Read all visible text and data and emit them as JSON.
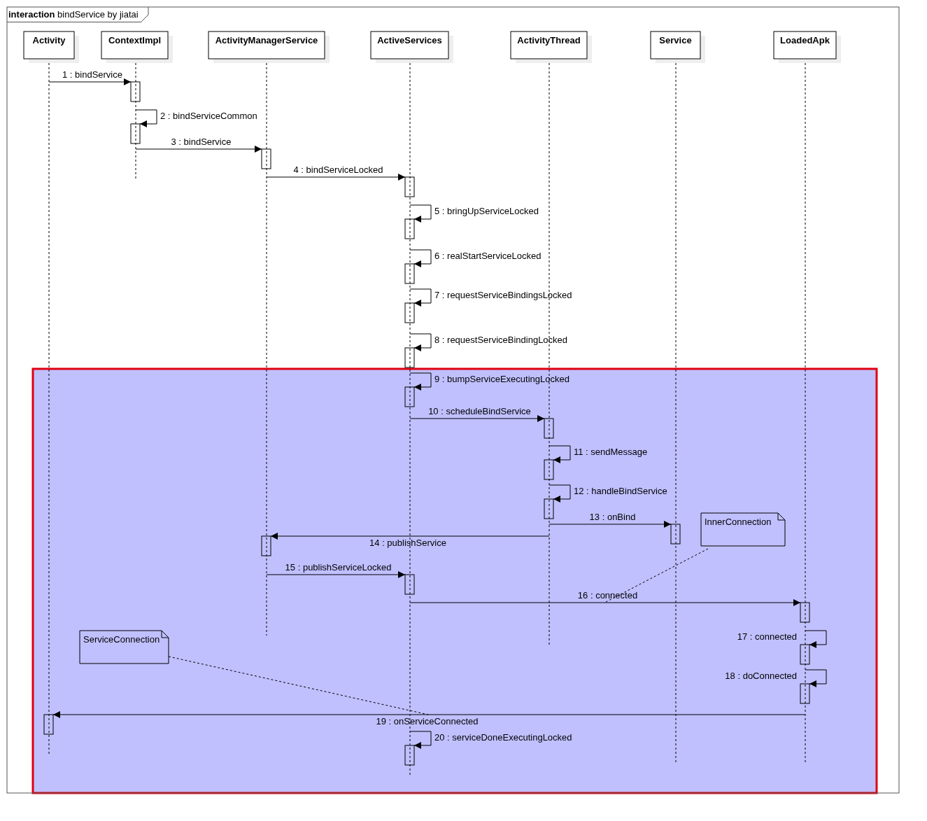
{
  "frame": {
    "title": "**interaction** bindService by jiatai"
  },
  "lifelines": [
    {
      "name": "Activity"
    },
    {
      "name": "ContextImpl"
    },
    {
      "name": "ActivityManagerService"
    },
    {
      "name": "ActiveServices"
    },
    {
      "name": "ActivityThread"
    },
    {
      "name": "Service"
    },
    {
      "name": "LoadedApk"
    }
  ],
  "messages": [
    {
      "label": "1 : bindService",
      "kind": "call"
    },
    {
      "label": "2 : bindServiceCommon",
      "kind": "self"
    },
    {
      "label": "3 : bindService",
      "kind": "call"
    },
    {
      "label": "4 : bindServiceLocked",
      "kind": "call"
    },
    {
      "label": "5 : bringUpServiceLocked",
      "kind": "self"
    },
    {
      "label": "6 : realStartServiceLocked",
      "kind": "self"
    },
    {
      "label": "7 : requestServiceBindingsLocked",
      "kind": "self"
    },
    {
      "label": "8 : requestServiceBindingLocked",
      "kind": "self"
    },
    {
      "label": "9 : bumpServiceExecutingLocked",
      "kind": "self"
    },
    {
      "label": "10 : scheduleBindService",
      "kind": "call"
    },
    {
      "label": "11 : sendMessage",
      "kind": "self"
    },
    {
      "label": "12 : handleBindService",
      "kind": "self"
    },
    {
      "label": "13 : onBind",
      "kind": "call"
    },
    {
      "label": "14 : publishService",
      "kind": "call"
    },
    {
      "label": "15 : publishServiceLocked",
      "kind": "call"
    },
    {
      "label": "16 : connected",
      "kind": "call"
    },
    {
      "label": "17 : connected",
      "kind": "self"
    },
    {
      "label": "18 : doConnected",
      "kind": "self"
    },
    {
      "label": "19 : onServiceConnected",
      "kind": "call"
    },
    {
      "label": "20 : serviceDoneExecutingLocked",
      "kind": "self"
    }
  ],
  "notes": [
    {
      "text": "InnerConnection"
    },
    {
      "text": "ServiceConnection"
    }
  ]
}
